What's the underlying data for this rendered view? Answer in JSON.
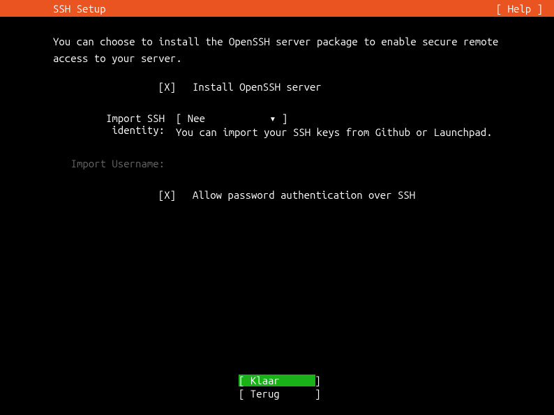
{
  "header": {
    "title": "SSH Setup",
    "help": "[ Help ]"
  },
  "description": "You can choose to install the OpenSSH server package to enable secure remote access to your server.",
  "install_row": {
    "checkbox": "[X]",
    "label": "Install OpenSSH server"
  },
  "import_identity": {
    "label": "Import SSH identity:",
    "select": "[ Nee           ▾ ]",
    "hint": "You can import your SSH keys from Github or Launchpad."
  },
  "import_username": {
    "label": "Import Username:"
  },
  "allow_password": {
    "checkbox": "[X]",
    "label": "Allow password authentication over SSH"
  },
  "footer": {
    "done": "[ Klaar      ]",
    "back": "[ Terug      ]"
  }
}
